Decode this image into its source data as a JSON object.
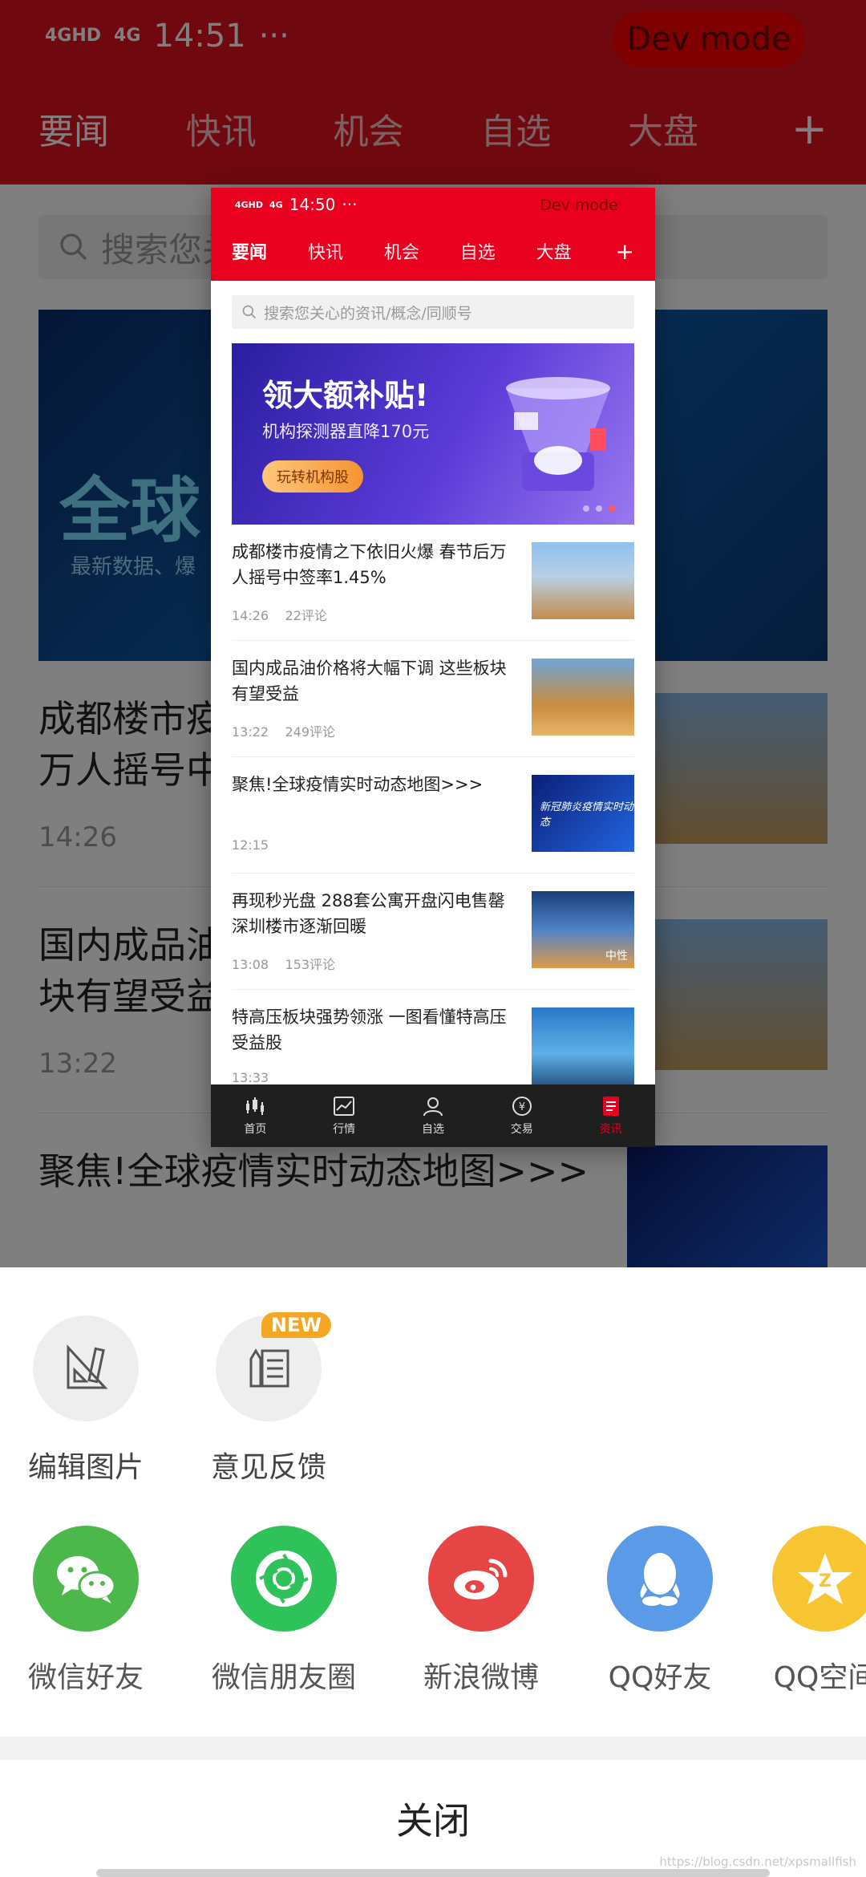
{
  "status_bar": {
    "time": "14:51",
    "signal_1": "4GHD",
    "signal_2": "4G",
    "more": "···"
  },
  "dev_mode": {
    "label": "Dev mode"
  },
  "tabs": [
    {
      "label": "要闻",
      "active": true
    },
    {
      "label": "快讯",
      "active": false
    },
    {
      "label": "机会",
      "active": false
    },
    {
      "label": "自选",
      "active": false
    },
    {
      "label": "大盘",
      "active": false
    }
  ],
  "search": {
    "placeholder": "搜索您关心的资讯/概念/同顺号"
  },
  "banner": {
    "headline": "领大额补贴!",
    "subtitle": "机构探测器直降170元",
    "cta": "玩转机构股",
    "bg_headline_partial": "全球",
    "bg_subtitle_partial": "最新数据、爆"
  },
  "news": [
    {
      "title": "成都楼市疫情之下依旧火爆 春节后万人摇号中签率1.45%",
      "time": "14:26",
      "comments": "22评论"
    },
    {
      "title": "国内成品油价格将大幅下调 这些板块有望受益",
      "time": "13:22",
      "comments": "249评论"
    },
    {
      "title": "聚焦!全球疫情实时动态地图>>>",
      "time": "12:15",
      "comments": "",
      "thumb_text": "新冠肺炎疫情实时动态"
    },
    {
      "title": "再现秒光盘 288套公寓开盘闪电售罄 深圳楼市逐渐回暖",
      "time": "13:08",
      "comments": "153评论",
      "thumb_text": "中性"
    },
    {
      "title": "特高压板块强势领涨 一图看懂特高压受益股",
      "time": "13:33",
      "comments": ""
    }
  ],
  "preview_status": {
    "time": "14:50"
  },
  "bottom_nav": [
    {
      "label": "首页",
      "icon": "candlestick-icon",
      "active": false
    },
    {
      "label": "行情",
      "icon": "chart-line-icon",
      "active": false
    },
    {
      "label": "自选",
      "icon": "user-icon",
      "active": false
    },
    {
      "label": "交易",
      "icon": "yuan-coin-icon",
      "active": false
    },
    {
      "label": "资讯",
      "icon": "news-icon",
      "active": true
    }
  ],
  "sheet": {
    "tools": [
      {
        "label": "编辑图片",
        "icon": "edit-image-icon"
      },
      {
        "label": "意见反馈",
        "icon": "feedback-icon",
        "badge": "NEW"
      }
    ],
    "share_targets": [
      {
        "label": "微信好友",
        "icon": "wechat-icon",
        "color": "#4cb84c"
      },
      {
        "label": "微信朋友圈",
        "icon": "moments-icon",
        "color": "#2fc25b"
      },
      {
        "label": "新浪微博",
        "icon": "weibo-icon",
        "color": "#e64545"
      },
      {
        "label": "QQ好友",
        "icon": "qq-icon",
        "color": "#5b9ae6"
      },
      {
        "label": "QQ空间",
        "icon": "qzone-icon",
        "color": "#f7c531"
      }
    ],
    "close_label": "关闭"
  },
  "watermark": "https://blog.csdn.net/xpsmallfish",
  "colors": {
    "brand_red": "#e8001e",
    "dim_overlay": "rgba(0,0,0,0.5)",
    "badge_orange": "#f5a623"
  }
}
